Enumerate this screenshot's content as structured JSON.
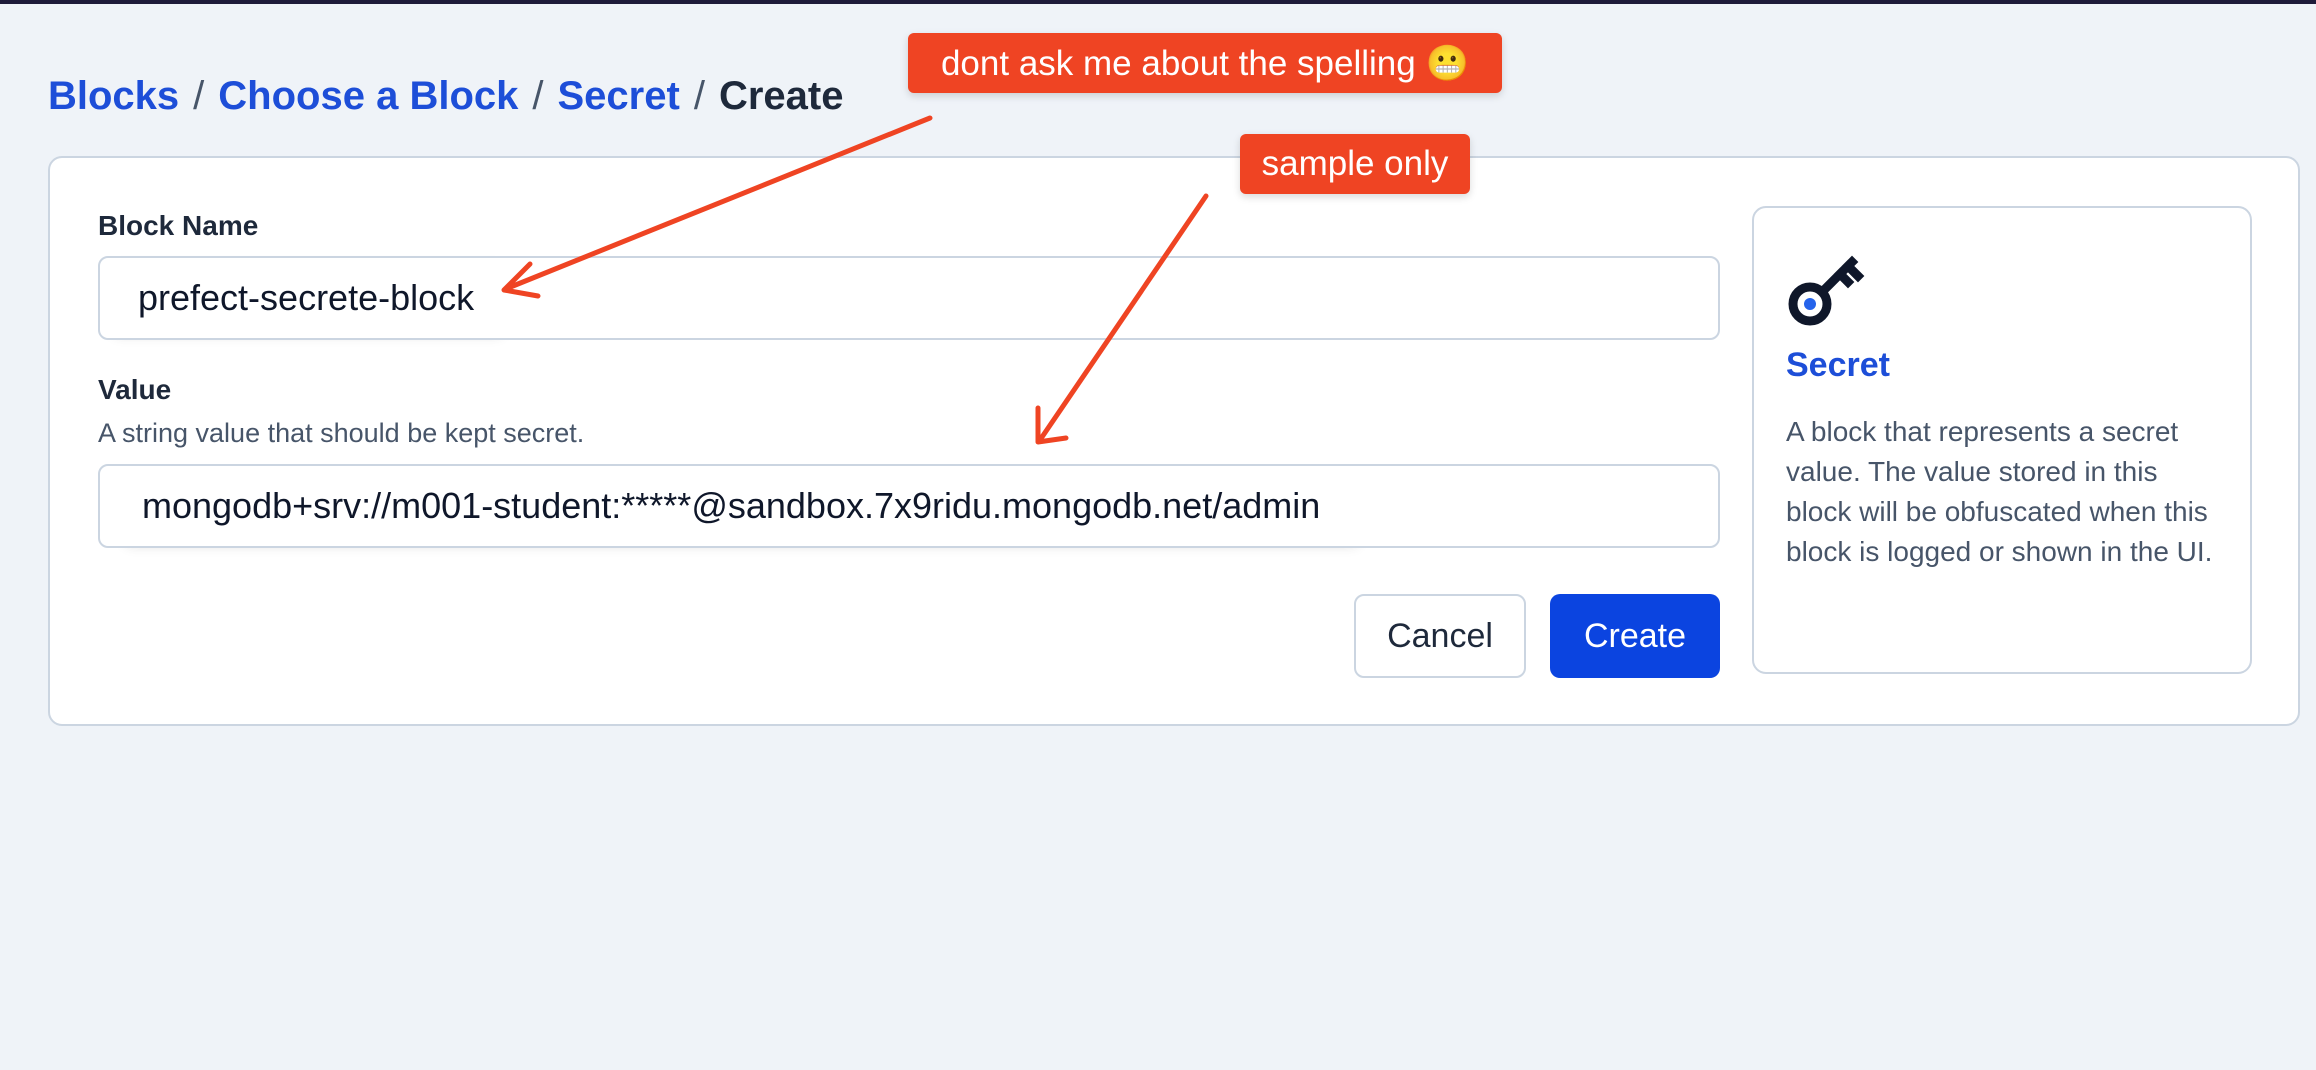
{
  "breadcrumb": {
    "items": [
      "Blocks",
      "Choose a Block",
      "Secret"
    ],
    "current": "Create",
    "separator": "/"
  },
  "form": {
    "block_name": {
      "label": "Block Name",
      "value": "prefect-secrete-block"
    },
    "value": {
      "label": "Value",
      "description": "A string value that should be kept secret.",
      "value": "mongodb+srv://m001-student:*****@sandbox.7x9ridu.mongodb.net/admin"
    },
    "cancel_label": "Cancel",
    "create_label": "Create"
  },
  "sidebar": {
    "icon": "key-icon",
    "title": "Secret",
    "description": "A block that represents a secret value. The value stored in this block will be obfuscated when this block is logged or shown in the UI."
  },
  "annotations": {
    "spelling_note": "dont ask me about the spelling 😬",
    "sample_note": "sample only"
  },
  "colors": {
    "accent": "#1d4ed8",
    "primary_button": "#0b44e0",
    "annotation": "#ef4423",
    "background": "#eff3f8"
  }
}
